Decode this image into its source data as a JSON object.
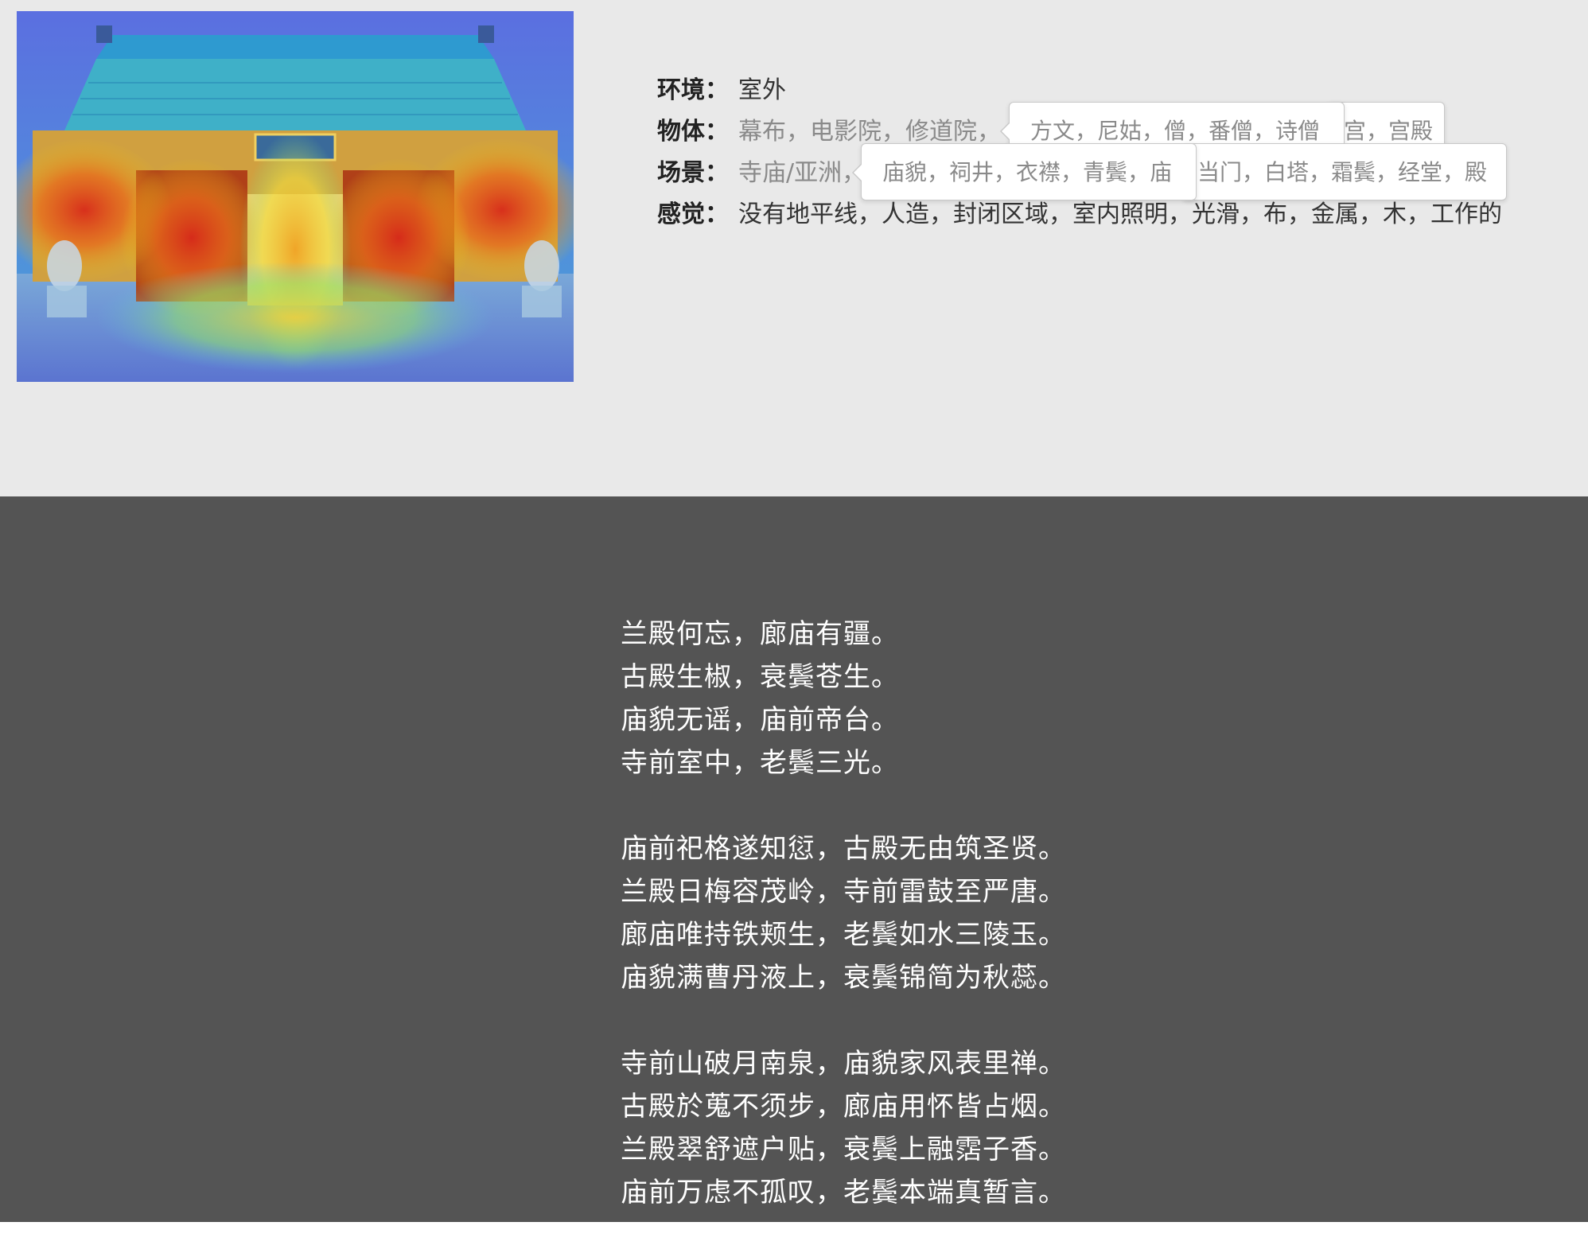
{
  "image": {
    "alt": "heatmap-overlay-photo",
    "plaque_text": "交通大學"
  },
  "info": {
    "environment": {
      "label": "环境：",
      "value": "室外"
    },
    "objects": {
      "label": "物体：",
      "value": "幕布，电影院，修道院，"
    },
    "scene": {
      "label": "场景：",
      "value": "寺庙/亚洲，"
    },
    "feeling": {
      "label": "感觉：",
      "value": "没有地平线，人造，封闭区域，室内照明，光滑，布，金属，木，工作的"
    }
  },
  "tooltips": {
    "objects_primary": "方文，尼姑，僧，番僧，诗僧",
    "objects_secondary": "宫，宫殿",
    "scene_primary": "庙貌，祠井，衣襟，青鬓，庙",
    "scene_secondary": "当门，白塔，霜鬓，经堂，殿"
  },
  "poem": {
    "stanzas": [
      [
        "兰殿何忘，廊庙有疆。",
        "古殿生椒，衰鬓苍生。",
        "庙貌无谣，庙前帝台。",
        "寺前室中，老鬓三光。"
      ],
      [
        "庙前祀格遂知愆，古殿无由筑圣贤。",
        "兰殿日梅容茂岭，寺前雷鼓至严唐。",
        "廊庙唯持铁颊生，老鬓如水三陵玉。",
        "庙貌满曹丹液上，衰鬓锦简为秋蕊。"
      ],
      [
        "寺前山破月南泉，庙貌家风表里禅。",
        "古殿於蒐不须步，廊庙用怀皆占烟。",
        "兰殿翠舒遮户贴，衰鬓上融霑子香。",
        "庙前万虑不孤叹，老鬓本端真暂言。"
      ]
    ]
  }
}
